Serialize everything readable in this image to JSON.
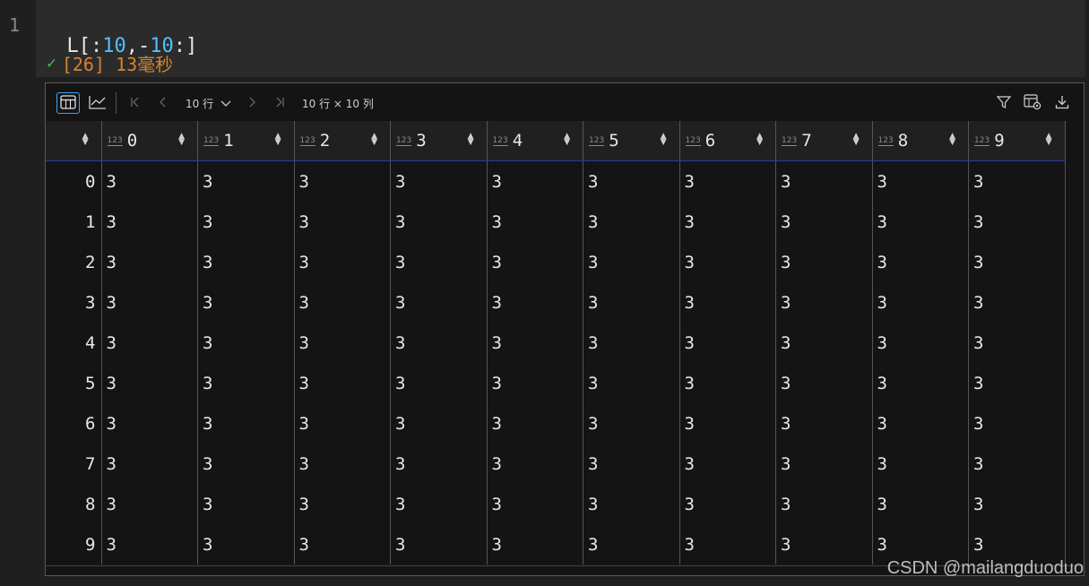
{
  "editor": {
    "line_number": "1",
    "code_tokens": [
      {
        "text": "L[:",
        "kind": "var"
      },
      {
        "text": "10",
        "kind": "num"
      },
      {
        "text": ",-",
        "kind": "var"
      },
      {
        "text": "10",
        "kind": "num"
      },
      {
        "text": ":]",
        "kind": "var"
      }
    ],
    "status_check": "✓",
    "status_text": "[26] 13毫秒"
  },
  "toolbar": {
    "table_view_icon": "table-icon",
    "chart_view_icon": "chart-icon",
    "first_page_icon": "first-page-icon",
    "prev_page_icon": "prev-page-icon",
    "page_size_label": "10 行",
    "next_page_icon": "next-page-icon",
    "last_page_icon": "last-page-icon",
    "shape_label": "10 行 × 10 列",
    "filter_icon": "filter-icon",
    "column_settings_icon": "table-settings-icon",
    "download_icon": "download-icon"
  },
  "table": {
    "type_badge": "123",
    "columns": [
      "0",
      "1",
      "2",
      "3",
      "4",
      "5",
      "6",
      "7",
      "8",
      "9"
    ],
    "index": [
      "0",
      "1",
      "2",
      "3",
      "4",
      "5",
      "6",
      "7",
      "8",
      "9"
    ],
    "rows": [
      [
        "3",
        "3",
        "3",
        "3",
        "3",
        "3",
        "3",
        "3",
        "3",
        "3"
      ],
      [
        "3",
        "3",
        "3",
        "3",
        "3",
        "3",
        "3",
        "3",
        "3",
        "3"
      ],
      [
        "3",
        "3",
        "3",
        "3",
        "3",
        "3",
        "3",
        "3",
        "3",
        "3"
      ],
      [
        "3",
        "3",
        "3",
        "3",
        "3",
        "3",
        "3",
        "3",
        "3",
        "3"
      ],
      [
        "3",
        "3",
        "3",
        "3",
        "3",
        "3",
        "3",
        "3",
        "3",
        "3"
      ],
      [
        "3",
        "3",
        "3",
        "3",
        "3",
        "3",
        "3",
        "3",
        "3",
        "3"
      ],
      [
        "3",
        "3",
        "3",
        "3",
        "3",
        "3",
        "3",
        "3",
        "3",
        "3"
      ],
      [
        "3",
        "3",
        "3",
        "3",
        "3",
        "3",
        "3",
        "3",
        "3",
        "3"
      ],
      [
        "3",
        "3",
        "3",
        "3",
        "3",
        "3",
        "3",
        "3",
        "3",
        "3"
      ],
      [
        "3",
        "3",
        "3",
        "3",
        "3",
        "3",
        "3",
        "3",
        "3",
        "3"
      ]
    ]
  },
  "watermark": "CSDN @mailangduoduo",
  "colors": {
    "accent": "#3aa3ff",
    "status": "#d9822b",
    "number_token": "#4fc1ff",
    "check": "#3fb950"
  }
}
